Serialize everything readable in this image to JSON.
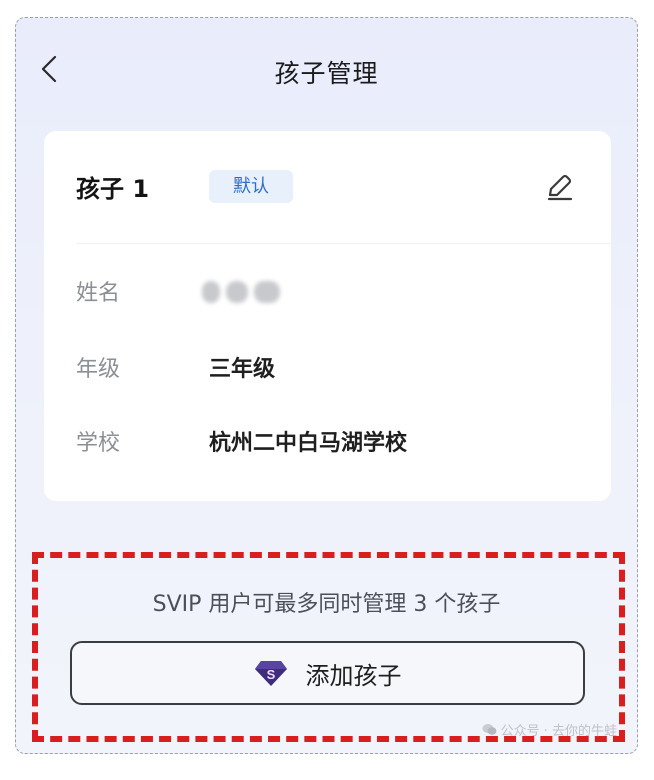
{
  "header": {
    "title": "孩子管理",
    "back_icon": "chevron-left-icon"
  },
  "child": {
    "name": "孩子 1",
    "badge": "默认",
    "edit_icon": "pencil-icon",
    "fields": [
      {
        "label": "姓名",
        "value": ""
      },
      {
        "label": "年级",
        "value": "三年级"
      },
      {
        "label": "学校",
        "value": "杭州二中白马湖学校"
      }
    ]
  },
  "promo": {
    "note": "SVIP 用户可最多同时管理 3 个孩子",
    "add_button_label": "添加孩子",
    "add_button_icon": "svip-diamond-icon"
  },
  "watermark": {
    "text": "公众号 · 去你的牛蛙",
    "icon": "wechat-icon"
  },
  "colors": {
    "badge_text": "#2d6ec9",
    "badge_bg": "#e8f0fb",
    "highlight_border": "#d81e1e",
    "svip_icon": "#3d2d7a"
  }
}
